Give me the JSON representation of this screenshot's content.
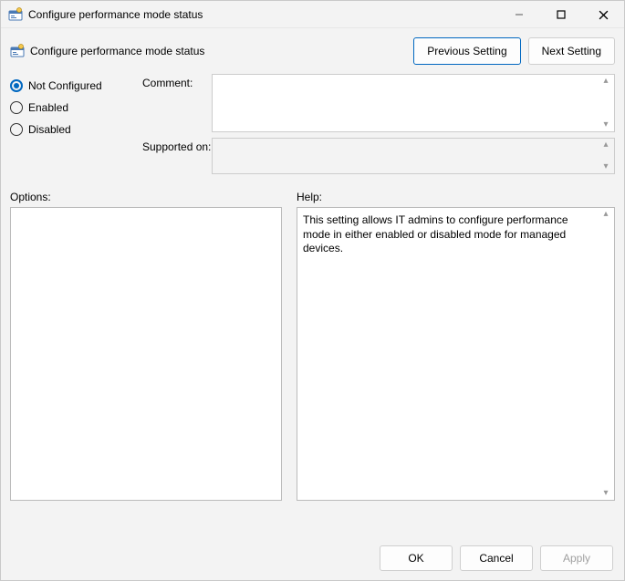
{
  "window": {
    "title": "Configure performance mode status"
  },
  "subheader": {
    "title": "Configure performance mode status",
    "previous": "Previous Setting",
    "next": "Next Setting"
  },
  "radios": {
    "not_configured": "Not Configured",
    "enabled": "Enabled",
    "disabled": "Disabled",
    "selected": "not_configured"
  },
  "fields": {
    "comment_label": "Comment:",
    "comment_value": "",
    "supported_label": "Supported on:",
    "supported_value": ""
  },
  "sections": {
    "options": "Options:",
    "help": "Help:"
  },
  "help_text": "This setting allows IT admins to configure performance mode in either enabled or disabled mode for managed devices.",
  "footer": {
    "ok": "OK",
    "cancel": "Cancel",
    "apply": "Apply"
  }
}
